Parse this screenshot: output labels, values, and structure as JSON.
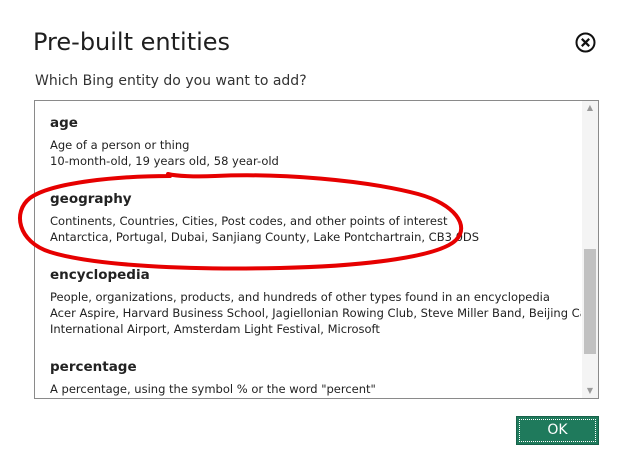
{
  "dialog": {
    "title": "Pre-built entities",
    "subtitle": "Which Bing entity do you want to add?",
    "ok_label": "OK"
  },
  "entities": [
    {
      "name": "age",
      "description": "Age of a person or thing",
      "examples_line1": "10-month-old, 19 years old, 58 year-old",
      "examples_line2": ""
    },
    {
      "name": "geography",
      "description": "Continents, Countries, Cities, Post codes, and other points of interest",
      "examples_line1": "Antarctica, Portugal, Dubai, Sanjiang County, Lake Pontchartrain, CB3 0DS",
      "examples_line2": ""
    },
    {
      "name": "encyclopedia",
      "description": "People, organizations, products, and hundreds of other types found in an encyclopedia",
      "examples_line1": "Acer Aspire, Harvard Business School, Jagiellonian Rowing Club, Steve Miller Band, Beijing Capital",
      "examples_line2": "International Airport, Amsterdam Light Festival, Microsoft"
    },
    {
      "name": "percentage",
      "description": "A percentage, using the symbol % or the word \"percent\"",
      "examples_line1": "",
      "examples_line2": ""
    }
  ],
  "icons": {
    "close": "close-icon",
    "scroll_up": "chevron-up-icon",
    "scroll_down": "chevron-down-icon"
  },
  "colors": {
    "ok_button": "#1f7a5c",
    "annotation": "#e60000"
  }
}
